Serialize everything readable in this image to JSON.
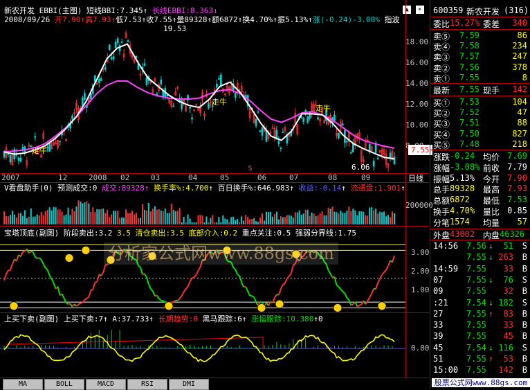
{
  "chart_header": {
    "stock_name": "新农开发",
    "indicator": "EBBI(主图)",
    "bbi_short": "短线BBI:7.345",
    "bbi_long": "长线EBBI:8.363",
    "quote_date": "2008/09/26",
    "open": "开7.90",
    "high": "高7.93",
    "low": "低7.53",
    "close": "收7.55",
    "volume": "量89328",
    "amount": "额6872",
    "turnover": "换4.70%",
    "amplitude": "振5.13%",
    "change": "涨(-0.24)-3.08%",
    "point_label": "指波"
  },
  "main_chart": {
    "y_labels": [
      "18.00",
      "16.00",
      "14.00",
      "12.00",
      "10.00",
      "8.00"
    ],
    "peak_label": "19.53",
    "low_label": "6.06",
    "current_price": "7.55",
    "annotations": [
      "走牛",
      "走牛",
      "走牛"
    ],
    "x_labels": [
      "2007",
      "12",
      "2008",
      "02",
      "03",
      "04",
      "05",
      "06",
      "07",
      "08",
      "09"
    ],
    "period": "日线"
  },
  "chart_data": [
    {
      "type": "line",
      "title": "EBBI(主图)",
      "series": [
        {
          "name": "短线BBI",
          "values": [
            8.0,
            7.8,
            7.9,
            8.2,
            8.6,
            9.3,
            10.2,
            11.3,
            12.8,
            14.8,
            16.8,
            17.8,
            18.2,
            16.5,
            15.0,
            14.2,
            13.4,
            12.8,
            12.4,
            12.2,
            13.0,
            14.2,
            14.6,
            13.6,
            12.2,
            10.7,
            9.5,
            9.1,
            10.0,
            11.6,
            11.6,
            11.5,
            10.7,
            9.6,
            8.8,
            8.3,
            7.9,
            7.5,
            7.35
          ]
        },
        {
          "name": "长线EBBI",
          "values": [
            8.0,
            8.1,
            8.2,
            8.4,
            8.8,
            9.5,
            10.3,
            11.3,
            12.4,
            13.5,
            14.3,
            14.7,
            14.7,
            14.1,
            13.6,
            13.3,
            13.1,
            13.0,
            13.0,
            13.1,
            13.5,
            13.8,
            13.9,
            13.5,
            12.8,
            11.9,
            11.1,
            10.8,
            11.2,
            11.7,
            11.8,
            11.5,
            11.0,
            10.3,
            9.6,
            9.1,
            8.8,
            8.55,
            8.36
          ]
        }
      ],
      "ylim": [
        6,
        20
      ]
    }
  ],
  "vol_panel": {
    "title": "V看盘助手(0) 预测成交:0",
    "vol": "成交:89328",
    "turnover_rate": "换手率%:4.700",
    "hundred_day": "百日换手%:646.983",
    "profit": "收益:-0.14",
    "float": "流通盘:1.901",
    "y_label": "200000"
  },
  "tower_panel": {
    "title": "宝塔顶底(副图) 阶段卖出:3.2",
    "clear_sell": "3.5 清仓卖出:3.5",
    "bottom_buy": "底部介入:0.2",
    "focus": "重点关注:0.5",
    "divide": "强弱分界线:1.75",
    "y_labels": [
      "3.00",
      "2.00",
      "1.00"
    ],
    "watermark": "分析家公式网www.88gs.com"
  },
  "bottom_panel": {
    "title": "上买下卖(副图)",
    "buy_sell": "上买下卖:7",
    "a_val": "A:37.733",
    "long_trend": "长期趋势:0",
    "dark_horse": "黑马跟踪:6",
    "rise_track": "涨幅跟踪:10.380",
    "zero": "0",
    "y_label": "0.00"
  },
  "tabs": [
    "MA",
    "BOLL",
    "MACD",
    "RSI",
    "DMI"
  ],
  "right_panel": {
    "code": "600359",
    "name": "新农开发",
    "count": "(316)",
    "weibi_label": "委比",
    "weibi_val": "15.27%",
    "weicha_label": "委差",
    "weicha_val": "340",
    "asks": [
      {
        "label": "卖⑤",
        "price": "7.59",
        "vol": "86"
      },
      {
        "label": "卖④",
        "price": "7.58",
        "vol": "234"
      },
      {
        "label": "卖③",
        "price": "7.57",
        "vol": "247"
      },
      {
        "label": "卖②",
        "price": "7.56",
        "vol": "378"
      },
      {
        "label": "卖①",
        "price": "7.55",
        "vol": "8"
      }
    ],
    "latest_label": "最新",
    "latest_val": "7.55",
    "current_label": "现手",
    "current_val": "142",
    "bids": [
      {
        "label": "买①",
        "price": "7.53",
        "vol": "104"
      },
      {
        "label": "买②",
        "price": "7.52",
        "vol": "47"
      },
      {
        "label": "买③",
        "price": "7.51",
        "vol": "88"
      },
      {
        "label": "买④",
        "price": "7.50",
        "vol": "827"
      },
      {
        "label": "买⑤",
        "price": "7.48",
        "vol": "218"
      }
    ],
    "stats": [
      {
        "l1": "涨跌",
        "v1": "-0.24",
        "l2": "均价",
        "v2": "7.69"
      },
      {
        "l1": "涨幅",
        "v1": "-3.08%",
        "l2": "前收",
        "v2": "7.79"
      },
      {
        "l1": "振幅",
        "v1": "5.13%",
        "l2": "今开",
        "v2": "7.90"
      },
      {
        "l1": "总手",
        "v1": "89328",
        "l2": "最高",
        "v2": "7.93"
      },
      {
        "l1": "总额",
        "v1": "6872",
        "l2": "最低",
        "v2": "7.53"
      },
      {
        "l1": "换手",
        "v1": "4.70%",
        "l2": "量比",
        "v2": "0.85"
      },
      {
        "l1": "分笔",
        "v1": "1574",
        "l2": "均量",
        "v2": "57"
      }
    ],
    "outer_label": "外盘",
    "outer_val": "43002",
    "inner_label": "内盘",
    "inner_val": "46326",
    "ticks": [
      {
        "t": "14:56",
        "p": "7.56",
        "a": "↓",
        "v": "51",
        "s": "S"
      },
      {
        "t": "",
        "p": "7.55",
        "a": "↓",
        "v": "263",
        "s": "B"
      },
      {
        "t": "14:59",
        "p": "7.55",
        "a": "",
        "v": "33",
        "s": "B"
      },
      {
        "t": "07",
        "p": "7.55",
        "a": "↓",
        "v": "76",
        "s": "S"
      },
      {
        "t": "09",
        "p": "7.55",
        "a": "",
        "v": "32",
        "s": "B"
      },
      {
        "t": ":21",
        "p": "7.54",
        "a": "↓",
        "v": "182",
        "s": "S"
      },
      {
        "t": "27",
        "p": "7.55",
        "a": "↑",
        "v": "83",
        "s": "B"
      },
      {
        "t": "33",
        "p": "7.55",
        "a": "",
        "v": "33",
        "s": "B"
      },
      {
        "t": "39",
        "p": "7.55",
        "a": "",
        "v": "45",
        "s": "B"
      },
      {
        "t": "45",
        "p": "7.54",
        "a": "↓",
        "v": "116",
        "s": "S"
      },
      {
        "t": "51",
        "p": "7.55",
        "a": "↑",
        "v": "53",
        "s": "B"
      },
      {
        "t": "15:00",
        "p": "7.55",
        "a": "",
        "v": "142",
        "s": "B"
      }
    ],
    "footer": "股票公式网www.88gs.com"
  }
}
